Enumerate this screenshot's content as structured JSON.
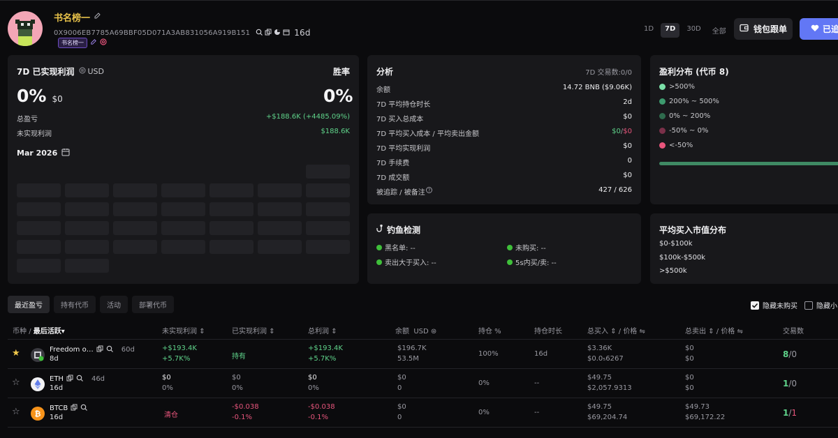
{
  "header": {
    "name": "书名榜一",
    "address": "0X9006EB7785A69BBF05D071A3AB831056A919B151",
    "age": "16d",
    "tag": "书名榜一",
    "timeframes": [
      "1D",
      "7D",
      "30D",
      "全部"
    ],
    "active_timeframe": "7D",
    "track_button": "钱包跟单",
    "follow_button": "已追"
  },
  "pnl_card": {
    "title": "7D 已实现利润",
    "currency": "USD",
    "win_rate_label": "胜率",
    "profit_pct": "0%",
    "profit_usd": "$0",
    "win_rate": "0%",
    "total_pnl_label": "总盈亏",
    "total_pnl_value": "+$188.6K (+4485.09%)",
    "unrealized_label": "未实现利润",
    "unrealized_value": "$188.6K",
    "month": "Mar 2026"
  },
  "analysis": {
    "title": "分析",
    "tx_count": "7D 交易数:0/0",
    "rows": [
      {
        "label": "余额",
        "value": "14.72 BNB ($9.06K)"
      },
      {
        "label": "7D 平均持仓时长",
        "value": "2d"
      },
      {
        "label": "7D 买入总成本",
        "value": "$0"
      },
      {
        "label": "7D 平均买入成本 / 平均卖出金额",
        "value_buy": "$0",
        "value_sep": "/",
        "value_sell": "$0"
      },
      {
        "label": "7D 平均实现利润",
        "value": "$0"
      },
      {
        "label": "7D 手续费",
        "value": "0"
      },
      {
        "label": "7D 成交额",
        "value": "$0"
      },
      {
        "label": "被追踪 / 被备注",
        "value": "427 / 626"
      }
    ]
  },
  "distribution": {
    "title": "盈利分布 (代币 8)",
    "items": [
      {
        "label": ">500%",
        "color": "#7be0a8"
      },
      {
        "label": "200% ~ 500%",
        "color": "#3d9a6e"
      },
      {
        "label": "0% ~ 200%",
        "color": "#2e6b4d"
      },
      {
        "label": "-50% ~ 0%",
        "color": "#7a3049"
      },
      {
        "label": "<-50%",
        "color": "#e8557c"
      }
    ]
  },
  "phishing": {
    "title": "钓鱼检测",
    "items": [
      {
        "label": "黑名单: --"
      },
      {
        "label": "未购买: --"
      },
      {
        "label": "卖出大于买入: --"
      },
      {
        "label": "5s内买/卖: --"
      }
    ]
  },
  "mcap": {
    "title": "平均买入市值分布",
    "items": [
      "$0-$100k",
      "$100k-$500k",
      ">$500k"
    ]
  },
  "tabs": [
    "最近盈亏",
    "持有代币",
    "活动",
    "部署代币"
  ],
  "filters": {
    "hide_unbought": "隐藏未购买",
    "hide_small": "隐藏小"
  },
  "table": {
    "headers": {
      "coin": "币种",
      "sep": "/",
      "last_active": "最后活跃",
      "unrealized": "未实现利润",
      "realized": "已实现利润",
      "total": "总利润",
      "balance": "余额",
      "balance_unit": "USD",
      "position": "持仓 %",
      "hold_time": "持仓时长",
      "total_buy": "总买入",
      "avg_price_buy": "价格",
      "total_sell": "总卖出",
      "avg_price_sell": "价格",
      "trades": "交易数"
    },
    "rows": [
      {
        "name": "Freedom o…",
        "age": "60d",
        "last": "8d",
        "unreal1": "+$193.4K",
        "unreal2": "+5.7K%",
        "realized1": "持有",
        "realized2": "",
        "total1": "+$193.4K",
        "total2": "+5.7K%",
        "bal1": "$196.7K",
        "bal2": "53.5M",
        "pos": "100%",
        "hold": "16d",
        "buy1": "$3.36K",
        "buy2": "$0.0₅6267",
        "sell1": "$0",
        "sell2": "$0",
        "trades_buy": "8",
        "trades_sep": "/",
        "trades_sell": "0"
      },
      {
        "name": "ETH",
        "age": "46d",
        "last": "16d",
        "unreal1": "$0",
        "unreal2": "0%",
        "realized1": "$0",
        "realized2": "0%",
        "total1": "$0",
        "total2": "0%",
        "bal1": "$0",
        "bal2": "0",
        "pos": "0%",
        "hold": "--",
        "buy1": "$49.75",
        "buy2": "$2,057.9313",
        "sell1": "$0",
        "sell2": "$0",
        "trades_buy": "1",
        "trades_sep": "/",
        "trades_sell": "0"
      },
      {
        "name": "BTCB",
        "age": "",
        "last": "16d",
        "unreal1": "清仓",
        "unreal2": "",
        "realized1": "-$0.038",
        "realized2": "-0.1%",
        "total1": "-$0.038",
        "total2": "-0.1%",
        "bal1": "$0",
        "bal2": "0",
        "pos": "0%",
        "hold": "--",
        "buy1": "$49.75",
        "buy2": "$69,204.74",
        "sell1": "$49.73",
        "sell2": "$69,172.22",
        "trades_buy": "1",
        "trades_sep": "/",
        "trades_sell": "1"
      }
    ]
  }
}
